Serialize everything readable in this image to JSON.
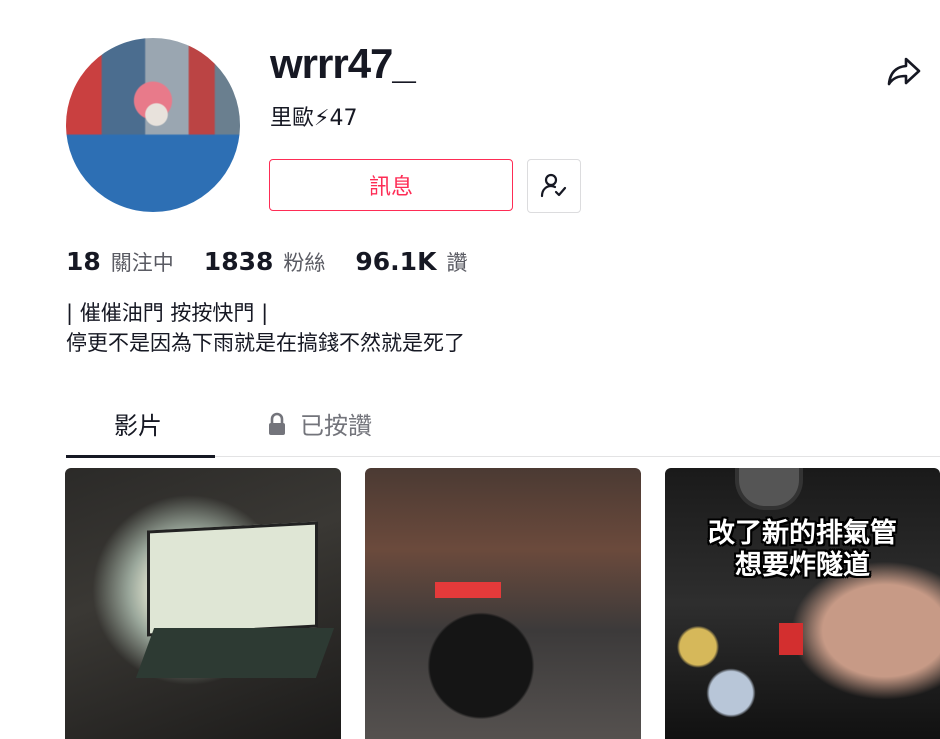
{
  "profile": {
    "username": "wrrr47_",
    "nickname": "里歐⚡47",
    "message_button": "訊息",
    "avatar_icon": "avatar-photo"
  },
  "stats": [
    {
      "value": "18",
      "label": "關注中"
    },
    {
      "value": "1838",
      "label": "粉絲"
    },
    {
      "value": "96.1K",
      "label": "讚"
    }
  ],
  "bio": {
    "line1": "| 催催油門 按按快門 |",
    "line2": "停更不是因為下雨就是在搞錢不然就是死了"
  },
  "tabs": {
    "videos": "影片",
    "liked": "已按讚",
    "liked_icon": "lock-icon"
  },
  "videos": [
    {
      "caption": ""
    },
    {
      "caption": ""
    },
    {
      "caption_line1": "改了新的排氣管",
      "caption_line2": "想要炸隧道"
    }
  ],
  "colors": {
    "accent": "#fe2c55",
    "text": "#161823",
    "muted": "#73747b"
  }
}
